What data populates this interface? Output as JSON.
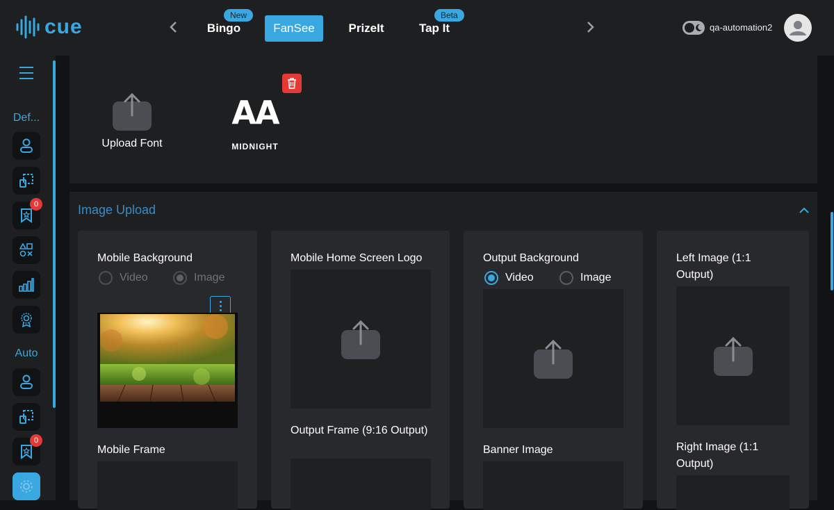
{
  "brand": {
    "name": "cue",
    "accent": "#3aa8e0"
  },
  "header": {
    "tabs": [
      {
        "label": "Bingo",
        "badge": "New"
      },
      {
        "label": "FanSee",
        "badge": "",
        "active": true
      },
      {
        "label": "PrizeIt",
        "badge": ""
      },
      {
        "label": "Tap It",
        "badge": "Beta"
      }
    ],
    "username": "qa-automation2"
  },
  "sidebar": {
    "sections": [
      {
        "label": "Def...",
        "items": [
          {
            "icon": "user-icon"
          },
          {
            "icon": "layout-icon"
          },
          {
            "icon": "ribbon-star-icon",
            "badge": "0"
          },
          {
            "icon": "shapes-icon"
          },
          {
            "icon": "bar-chart-icon"
          },
          {
            "icon": "award-icon"
          }
        ]
      },
      {
        "label": "Auto",
        "items": [
          {
            "icon": "user-icon"
          },
          {
            "icon": "layout-icon"
          },
          {
            "icon": "ribbon-star-icon",
            "badge": "0"
          },
          {
            "icon": "settings-icon",
            "active": true
          }
        ]
      }
    ]
  },
  "fonts": {
    "upload_label": "Upload Font",
    "preview_glyphs": "AA",
    "preview_name": "MIDNIGHT"
  },
  "image_upload": {
    "title": "Image Upload",
    "cards": [
      {
        "title": "Mobile Background",
        "radio_options": [
          "Video",
          "Image"
        ],
        "selected": "Image",
        "disabled": true,
        "second_title": "Mobile Frame"
      },
      {
        "title": "Mobile Home Screen Logo",
        "second_title": "Output Frame (9:16 Output)"
      },
      {
        "title": "Output Background",
        "radio_options": [
          "Video",
          "Image"
        ],
        "selected": "Video",
        "second_title": "Banner Image"
      },
      {
        "title": "Left Image (1:1 Output)",
        "second_title": "Right Image (1:1 Output)"
      }
    ]
  }
}
